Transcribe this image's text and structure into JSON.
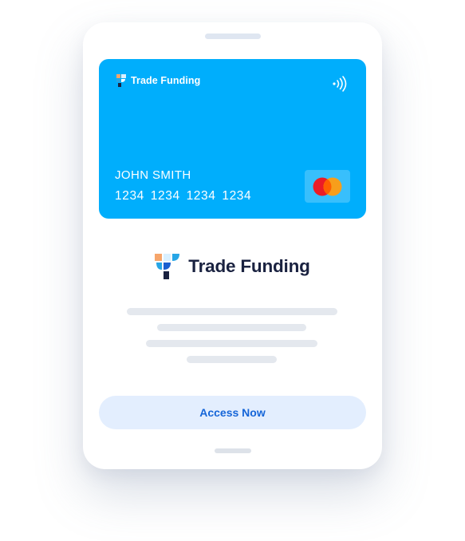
{
  "card": {
    "brand_name": "Trade Funding",
    "holder_name": "JOHN SMITH",
    "number": "1234 1234 1234 1234",
    "background_color": "#00aefc",
    "network_icon": "mastercard-logo",
    "contactless_icon": "contactless-icon"
  },
  "brand": {
    "name": "Trade Funding",
    "logo_colors": [
      "#f6a56b",
      "#d9f0ff",
      "#1a5fd0",
      "#27a6e6",
      "#1a2240"
    ]
  },
  "content_placeholder_lines": 4,
  "cta": {
    "label": "Access Now",
    "background_color": "#e3eefe",
    "text_color": "#1565d8"
  }
}
